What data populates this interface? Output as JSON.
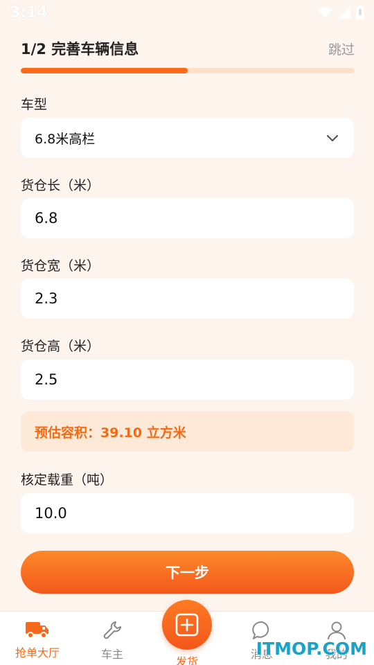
{
  "status_bar": {
    "time": "3:14"
  },
  "header": {
    "title": "1/2 完善车辆信息",
    "skip_label": "跳过"
  },
  "progress": {
    "fraction": 0.5
  },
  "form": {
    "vehicle_type": {
      "label": "车型",
      "value": "6.8米高栏"
    },
    "cargo_length": {
      "label": "货仓长（米）",
      "value": "6.8"
    },
    "cargo_width": {
      "label": "货仓宽（米）",
      "value": "2.3"
    },
    "cargo_height": {
      "label": "货仓高（米）",
      "value": "2.5"
    },
    "estimate": {
      "text": "预估容积：39.10 立方米"
    },
    "load_capacity": {
      "label": "核定载重（吨）",
      "value": "10.0"
    }
  },
  "next_button": {
    "label": "下一步"
  },
  "tabbar": {
    "items": [
      {
        "label": "抢单大厅",
        "icon": "truck-icon",
        "active": true
      },
      {
        "label": "车主",
        "icon": "wrench-icon",
        "active": false
      },
      {
        "label": "发货",
        "icon": "plus-icon",
        "active": false
      },
      {
        "label": "消息",
        "icon": "chat-icon",
        "active": false
      },
      {
        "label": "我的",
        "icon": "user-icon",
        "active": false
      }
    ]
  },
  "watermark": {
    "text": "ITMOP.COM"
  },
  "colors": {
    "accent": "#f56a1a",
    "background": "#fdf4ed",
    "estimate_bg": "#fde9d8"
  }
}
